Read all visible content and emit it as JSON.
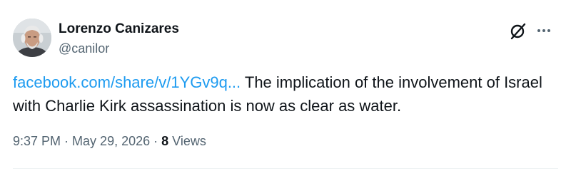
{
  "author": {
    "name": "Lorenzo Canizares",
    "handle": "@canilor"
  },
  "post": {
    "link_text": "facebook.com/share/v/1YGv9q...",
    "text": " The implication of the involvement of Israel with Charlie Kirk assassination is now as clear as water."
  },
  "meta": {
    "time": "9:37 PM",
    "separator1": " · ",
    "date": "May 29, 2026",
    "separator2": " · ",
    "views_count": "8",
    "views_label": " Views"
  },
  "icons": {
    "grok": "grok-icon",
    "more": "more-icon",
    "avatar": "avatar"
  },
  "colors": {
    "text": "#0f1419",
    "secondary": "#536471",
    "link": "#1d9bf0"
  }
}
